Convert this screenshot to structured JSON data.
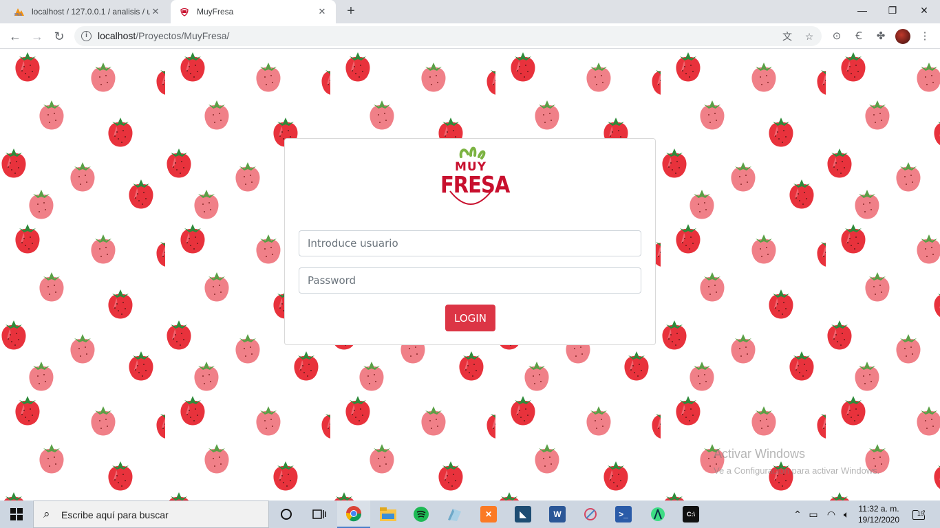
{
  "browser": {
    "tabs": [
      {
        "title": "localhost / 127.0.0.1 / analisis / u",
        "active": false
      },
      {
        "title": "MuyFresa",
        "active": true
      }
    ],
    "new_tab_label": "+",
    "window_controls": {
      "minimize": "—",
      "restore": "❐",
      "close": "✕"
    },
    "url": {
      "host": "localhost",
      "path": "/Proyectos/MuyFresa/"
    }
  },
  "page": {
    "logo": {
      "line1": "MUY",
      "line2": "FRESA"
    },
    "form": {
      "username_placeholder": "Introduce usuario",
      "password_placeholder": "Password",
      "login_label": "LOGIN"
    },
    "colors": {
      "accent": "#dc3545",
      "brand": "#c8102e"
    }
  },
  "watermark": {
    "title": "Activar Windows",
    "subtitle": "Ve a Configuración para activar Windows."
  },
  "taskbar": {
    "search_placeholder": "Escribe aquí para buscar",
    "apps": [
      "task-view",
      "chrome",
      "file-explorer",
      "spotify",
      "visual-studio-code",
      "xampp",
      "mysql-workbench",
      "word",
      "app-icon",
      "powershell",
      "android-studio",
      "terminal"
    ],
    "clock": {
      "time": "11:32 a. m.",
      "date": "19/12/2020"
    },
    "notifications_count": "19"
  }
}
